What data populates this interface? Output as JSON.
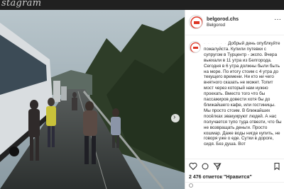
{
  "app": {
    "logo": "stagram"
  },
  "post": {
    "username": "belgorod.chs",
    "location": "Belgorod",
    "comment_user": "· · · · · ·",
    "comment_text": "Добрый день опублкуйте пожалуйста. Купили путевки с супругом в Турцентр - экспо. Вчера выехали в 11 утра из Белгорода. Сегодня в 6 утра должны были быть на море. По итогу стоим с 4 утра до текущего времени. Ни кто ни чего внятного сказать не может. Топит мост через который нам нужно проехать. Вместо того что бы пассажиров довести хотя бы до ближайшего кафе, или гостиницы. Мы просто стоим. В ближайших посёлках эвакуируют людей. А нас получается тупо туда отвезти, что бы не возвращать деньги. Просто кошмар. Даже воды нигде купить, не говоря уже о еде. Сутки в дороге, сидя. Без душа. Вот",
    "likes": "2 476 отметок \"Нравится\""
  },
  "icons": [
    "more-icon",
    "heart-icon",
    "comment-icon",
    "share-icon",
    "bookmark-icon",
    "next-arrow-icon",
    "emoji-icon"
  ]
}
